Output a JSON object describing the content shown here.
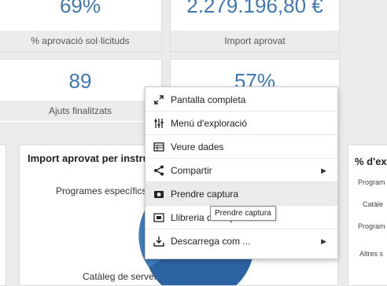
{
  "kpis": {
    "top_left_value": "69%",
    "top_left_label": "% aprovació sol·licituds",
    "top_right_value": "2.279.196,80 €",
    "top_right_label": "Import aprovat",
    "mid_left_value": "89",
    "mid_left_label": "Ajuts finalitzats",
    "mid_right_value": "57%"
  },
  "chart_left": {
    "title": "Import aprovat per instru",
    "label_top": "Programes específics",
    "label_bottom": "Catàleg de serveis",
    "colors": [
      "#3f7fc1",
      "#2c63a3",
      "#b9d3ea"
    ]
  },
  "chart_right": {
    "title": "% d'ex",
    "labels": [
      "Program",
      "Catàle",
      "Program",
      "Altres s"
    ]
  },
  "context_menu": {
    "items": [
      {
        "label": "Pantalla completa",
        "icon": "fullscreen-icon"
      },
      {
        "label": "Menú d'exploració",
        "icon": "sliders-icon"
      },
      {
        "label": "Veure dades",
        "icon": "table-icon"
      },
      {
        "label": "Compartir",
        "icon": "share-icon",
        "submenu": "▶"
      },
      {
        "label": "Prendre captura",
        "icon": "camera-icon"
      },
      {
        "label": "Llibreria de captures",
        "icon": "gallery-icon"
      },
      {
        "label": "Descarrega com ...",
        "icon": "download-icon",
        "submenu": "▶"
      }
    ],
    "tooltip": "Prendre captura"
  }
}
